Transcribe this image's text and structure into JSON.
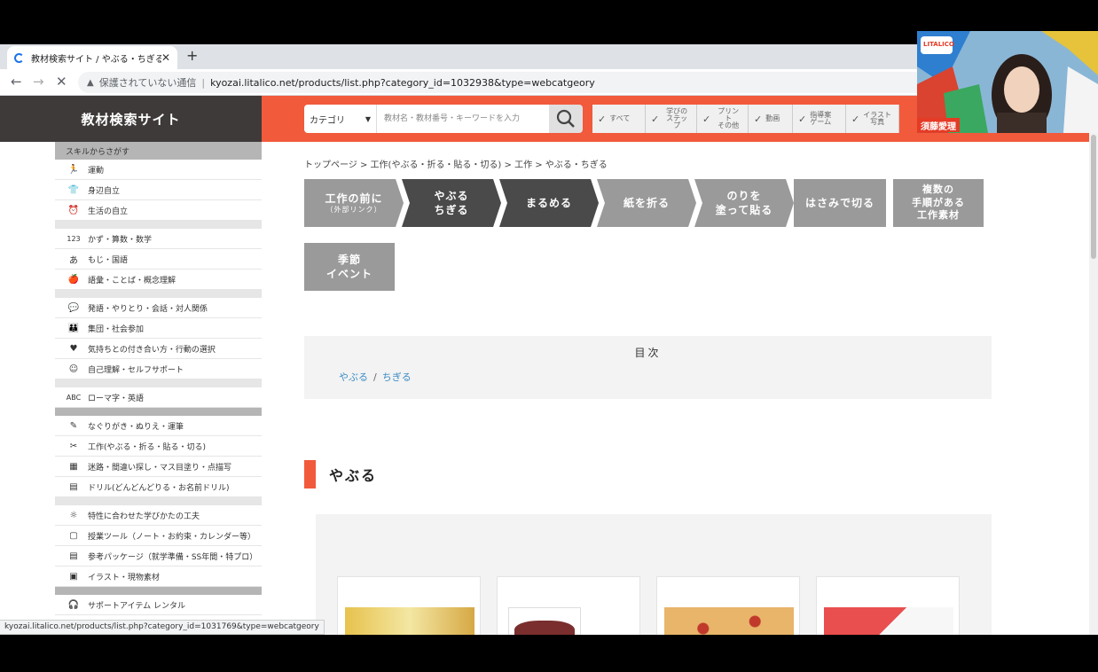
{
  "browser": {
    "tab_title": "教材検索サイト / やぶる・ちぎる",
    "close_glyph": "✕",
    "new_tab_glyph": "+",
    "back_glyph": "←",
    "forward_glyph": "→",
    "stop_glyph": "✕",
    "security_text": "保護されていない通信",
    "url": "kyozai.litalico.net/products/list.php?category_id=1032938&type=webcatgeory"
  },
  "site": {
    "logo": "教材検索サイト",
    "category_select": "カテゴリ",
    "search_placeholder": "教材名・教材番号・キーワードを入力",
    "filters": [
      "すべて",
      "学びの\nステップ",
      "プリント\nその他",
      "動画",
      "指導案\nゲーム",
      "イラスト\n写真"
    ]
  },
  "sidebar": {
    "header": "スキルからさがす",
    "items": [
      {
        "label": "運動",
        "icon": "🏃"
      },
      {
        "label": "身辺自立",
        "icon": "👕"
      },
      {
        "label": "生活の自立",
        "icon": "⏰"
      },
      {
        "label": "かず・算数・数学",
        "icon": "123"
      },
      {
        "label": "もじ・国語",
        "icon": "あ"
      },
      {
        "label": "語彙・ことば・概念理解",
        "icon": "🍎"
      },
      {
        "label": "発語・やりとり・会話・対人関係",
        "icon": "💬"
      },
      {
        "label": "集団・社会参加",
        "icon": "👪"
      },
      {
        "label": "気持ちとの付き合い方・行動の選択",
        "icon": "♥"
      },
      {
        "label": "自己理解・セルフサポート",
        "icon": "☺"
      },
      {
        "label": "ローマ字・英語",
        "icon": "ABC"
      },
      {
        "label": "なぐりがき・ぬりえ・運筆",
        "icon": "✎"
      },
      {
        "label": "工作(やぶる・折る・貼る・切る)",
        "icon": "✂"
      },
      {
        "label": "迷路・間違い探し・マス目塗り・点描写",
        "icon": "▦"
      },
      {
        "label": "ドリル(どんどんどりる・お名前ドリル)",
        "icon": "▤"
      },
      {
        "label": "特性に合わせた学びかたの工夫",
        "icon": "☼"
      },
      {
        "label": "授業ツール（ノート・お約束・カレンダー等）",
        "icon": "▢"
      },
      {
        "label": "参考パッケージ（就学準備・SS年間・特プロ）",
        "icon": "▤"
      },
      {
        "label": "イラスト・現物素材",
        "icon": "▣"
      },
      {
        "label": "サポートアイテム レンタル",
        "icon": "🎧"
      }
    ]
  },
  "main": {
    "breadcrumb": "トップページ > 工作(やぶる・折る・貼る・切る) > 工作 > やぶる・ちぎる",
    "steps": [
      {
        "line1": "工作の前に",
        "line2": "（外部リンク）"
      },
      {
        "line1": "やぶる",
        "line2": "ちぎる"
      },
      {
        "line1": "まるめる",
        "line2": ""
      },
      {
        "line1": "紙を折る",
        "line2": ""
      },
      {
        "line1": "のりを",
        "line2": "塗って貼る"
      },
      {
        "line1": "はさみで切る",
        "line2": ""
      },
      {
        "line1": "複数の\n手順がある\n工作素材",
        "line2": ""
      },
      {
        "line1": "季節",
        "line2": "イベント"
      }
    ],
    "toc_title": "目次",
    "toc_link1": "やぶる",
    "toc_slash": "/",
    "toc_link2": "ちぎる",
    "section_title": "やぶる"
  },
  "status_url": "kyozai.litalico.net/products/list.php?category_id=1031769&type=webcatgeory",
  "webcam": {
    "name": "須藤愛理",
    "logo_text": "LITALICO"
  },
  "colors": {
    "accent": "#f15a3b",
    "dark": "#3e3a39",
    "step_gray": "#9a9a9a",
    "step_dark": "#4a4a4a",
    "link": "#3c8dc5"
  }
}
